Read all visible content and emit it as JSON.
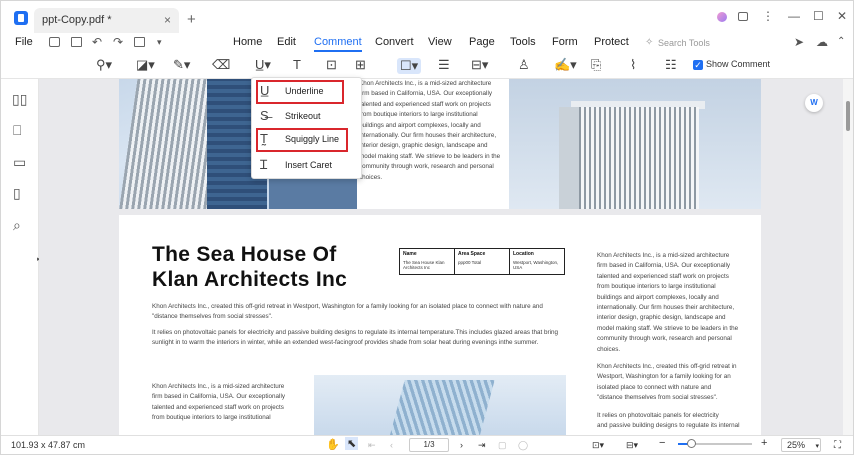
{
  "window": {
    "tab_title": "ppt-Copy.pdf *",
    "close_tab": "×",
    "new_tab": "+",
    "minimize": "—",
    "maximize": "☐",
    "close": "✕",
    "menu_more": "⋮"
  },
  "menu": {
    "file": "File",
    "items": [
      "Home",
      "Edit",
      "Comment",
      "Convert",
      "View",
      "Page",
      "Tools",
      "Form",
      "Protect"
    ],
    "active": "Comment",
    "search_placeholder": "Search Tools"
  },
  "toolbar": {
    "show_comment": "Show Comment",
    "show_comment_checked": true
  },
  "dropdown": {
    "items": [
      {
        "icon": "U̲",
        "label": "Underline",
        "highlighted": true
      },
      {
        "icon": "S̶",
        "label": "Strikeout",
        "highlighted": false
      },
      {
        "icon": "T̰",
        "label": "Squiggly Line",
        "highlighted": true
      },
      {
        "icon": "Ɪ",
        "label": "Insert Caret",
        "highlighted": false
      }
    ]
  },
  "page1": {
    "lines": [
      "Khon Architects Inc., is a mid-sized architecture",
      "firm based in California, USA. Our exceptionally",
      "talented and experienced staff work on projects",
      "from boutique interiors to large institutional",
      "buildings and airport complexes, locally and",
      "internationally. Our firm houses their architecture,",
      "interior design, graphic design, landscape and",
      "model making staff. We strieve to be leaders in the",
      "community through work, research and personal",
      "choices."
    ]
  },
  "page2": {
    "title_line1": "The Sea House Of",
    "title_line2": "Klan Architects Inc",
    "table": [
      {
        "label": "Name",
        "value": "The Sea House Klan Architects Inc"
      },
      {
        "label": "Area Space",
        "value": "ppp00 Total"
      },
      {
        "label": "Location",
        "value": "Westport, Washington, USA"
      }
    ],
    "para1_lines": [
      "Khon Architects Inc., created this off-grid retreat in Westport, Washington for a family looking for an isolated place to connect with nature and",
      "\"distance themselves from social stresses\"."
    ],
    "para2_lines": [
      "It relies on photovoltaic panels for electricity and passive building designs to regulate its internal temperature.This includes glazed areas that bring",
      "sunlight in to warm the interiors in winter, while an extended west-facingroof provides shade from solar heat during evenings inthe summer."
    ],
    "bottom_left_lines": [
      "Khon Architects Inc., is a mid-sized architecture",
      "firm based in California, USA. Our exceptionally",
      "talented and experienced staff work on projects",
      "from boutique interiors to large institutional"
    ],
    "right_col_lines": [
      "Khon Architects Inc., is a mid-sized architecture",
      "firm based in California, USA. Our exceptionally",
      "talented and experienced staff work on projects",
      "from boutique interiors to large institutional",
      "buildings and airport complexes, locally and",
      "internationally. Our firm houses their architecture,",
      "interior design, graphic design, landscape and",
      "model making staff. We strieve to be leaders in the",
      "community through work, research and personal",
      "choices.",
      "",
      "Khon Architects Inc., created this off-grid retreat in",
      "Westport, Washington for a family looking for an",
      "isolated place to connect with nature and",
      "\"distance themselves from social stresses\".",
      "",
      "It relies on photovoltaic panels for electricity",
      "and passive building designs to regulate its internal"
    ]
  },
  "status": {
    "dimensions": "101.93 x 47.87 cm",
    "page": "1/3",
    "zoom": "25%",
    "zoom_fraction": 0.18
  }
}
